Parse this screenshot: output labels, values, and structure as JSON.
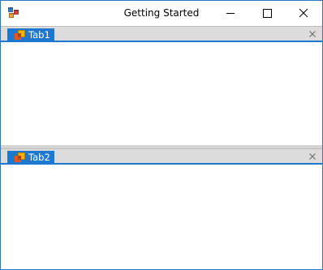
{
  "window": {
    "title": "Getting Started",
    "icons": {
      "app": "app-icon",
      "minimize": "minimize-icon",
      "maximize": "maximize-icon",
      "close": "close-icon"
    }
  },
  "tab_groups": [
    {
      "tabs": [
        {
          "label": "Tab1",
          "icon": "tab-document-icon",
          "selected": true
        }
      ],
      "close_icon": "close-icon"
    },
    {
      "tabs": [
        {
          "label": "Tab2",
          "icon": "tab-document-icon",
          "selected": true
        }
      ],
      "close_icon": "close-icon"
    }
  ],
  "colors": {
    "accent": "#1e78cf",
    "window_border": "#2b79c2",
    "tabstrip": "#dcdcdc",
    "splitter": "#d3d3d3"
  }
}
